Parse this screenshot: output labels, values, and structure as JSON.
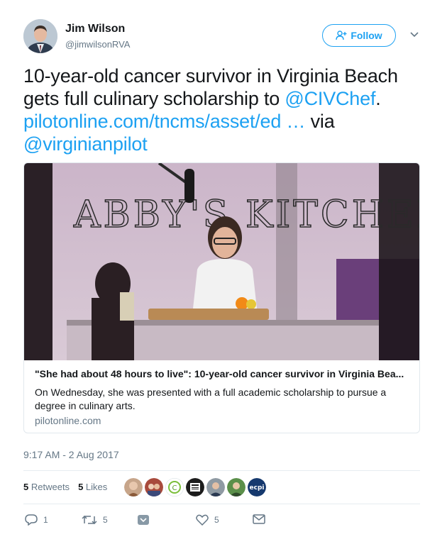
{
  "author": {
    "name": "Jim Wilson",
    "handle": "@jimwilsonRVA"
  },
  "follow_label": "Follow",
  "tweet": {
    "text_plain_1": "10-year-old cancer survivor in Virginia Beach gets full culinary scholarship to ",
    "mention_1": "@CIVChef",
    "text_plain_2": ". ",
    "link": "pilotonline.com/tncms/asset/ed",
    "ellipsis": " …",
    "text_plain_3": " via ",
    "mention_2": "@virginianpilot"
  },
  "card": {
    "title": "\"She had about 48 hours to live\": 10-year-old cancer survivor in Virginia Bea...",
    "description": "On Wednesday, she was presented with a full academic scholarship to pursue a degree in culinary arts.",
    "domain": "pilotonline.com",
    "image_wall_text": "ABBY'S KITCHEN"
  },
  "timestamp": "9:17 AM - 2 Aug 2017",
  "stats": {
    "retweets_count": "5",
    "retweets_label": "Retweets",
    "likes_count": "5",
    "likes_label": "Likes"
  },
  "likers_logo_text": "ecpi",
  "actions": {
    "reply_count": "1",
    "retweet_count": "5",
    "like_count": "5"
  },
  "colors": {
    "accent": "#1da1f2",
    "secondary_text": "#657786"
  }
}
